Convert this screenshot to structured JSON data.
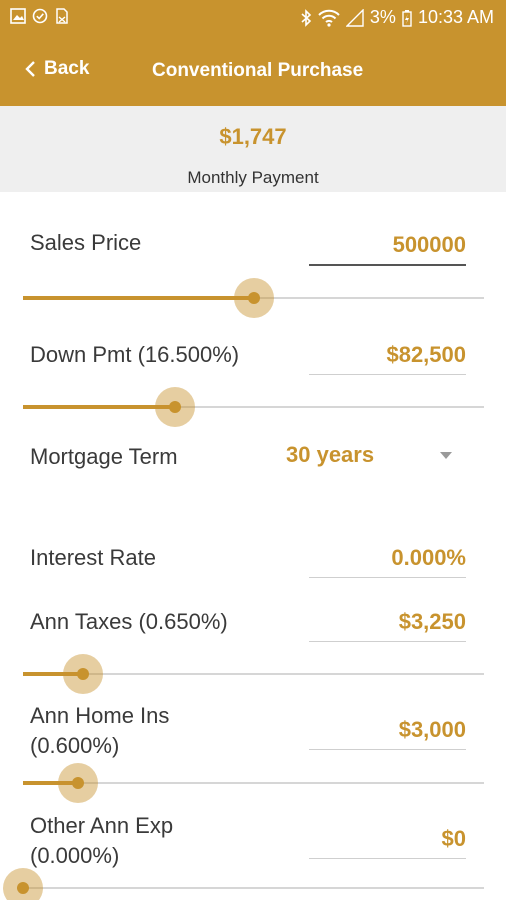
{
  "status_bar": {
    "battery": "3%",
    "time": "10:33 AM"
  },
  "app_bar": {
    "back_label": "Back",
    "title": "Conventional Purchase"
  },
  "summary": {
    "amount": "$1,747",
    "label": "Monthly Payment"
  },
  "form": {
    "sales_price": {
      "label": "Sales Price",
      "value": "500000",
      "slider_level": 0.5
    },
    "down_pmt": {
      "label": "Down Pmt (16.500%)",
      "value": "$82,500",
      "slider_level": 0.33
    },
    "mortgage_term": {
      "label": "Mortgage Term",
      "value": "30 years"
    },
    "interest_rate": {
      "label": "Interest Rate",
      "value": "0.000%"
    },
    "ann_taxes": {
      "label": "Ann Taxes (0.650%)",
      "value": "$3,250",
      "slider_level": 0.13
    },
    "ann_home_ins": {
      "label_line1": "Ann Home Ins",
      "label_line2": "(0.600%)",
      "value": "$3,000",
      "slider_level": 0.12
    },
    "other_ann_exp": {
      "label_line1": "Other Ann Exp",
      "label_line2": "(0.000%)",
      "value": "$0",
      "slider_level": 0.0
    }
  },
  "colors": {
    "accent": "#c8932e",
    "summary_bg": "#efefef",
    "text": "#3a3a3a"
  }
}
